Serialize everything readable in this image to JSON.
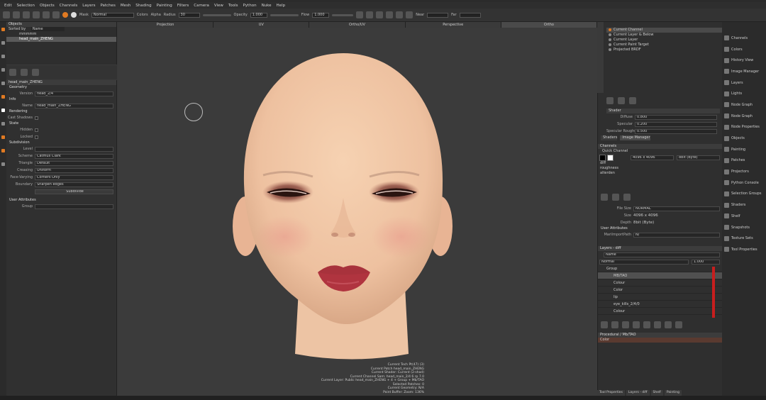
{
  "menu": [
    "Edit",
    "Selection",
    "Objects",
    "Channels",
    "Layers",
    "Patches",
    "Mesh",
    "Shading",
    "Painting",
    "Filters",
    "Camera",
    "View",
    "Tools",
    "Python",
    "Nuke",
    "Help"
  ],
  "toolbar": {
    "mask_label": "Mask",
    "mask_value": "Normal",
    "colors_label": "Colors",
    "alpha_label": "Alpha",
    "radius_label": "Radius",
    "radius_value": "30",
    "opacity_label": "Opacity",
    "opacity_value": "1.000",
    "flow_label": "Flow",
    "flow_value": "1.000",
    "near_label": "Near",
    "far_label": "Far"
  },
  "objects": {
    "title": "Objects",
    "sortby_label": "Sorted by",
    "sortby_value": "Name",
    "items": [
      "mmmmm",
      "head_main_ZHENG"
    ]
  },
  "properties": {
    "title": "head_main_ZHENG",
    "geometry": "Geometry",
    "version_label": "Version",
    "version_value": "head_2/4",
    "info": "Info",
    "name_label": "Name",
    "name_value": "head_main_ZHENG",
    "rendering": "Rendering",
    "cast_shadows": "Cast Shadows",
    "state": "State",
    "hidden": "Hidden",
    "locked": "Locked",
    "subdivision": "Subdivision",
    "level_label": "Level",
    "scheme_label": "Scheme",
    "scheme_value": "Catmull Clark",
    "triangle_label": "Triangle",
    "triangle_value": "Default",
    "creasing_label": "Creasing",
    "creasing_value": "Uniform",
    "facevarying_label": "Face-Varying",
    "facevarying_value": "Corners Only",
    "boundary_label": "Boundary",
    "boundary_value": "Sharpen edges",
    "subdivide_button": "Subdivide",
    "user_attributes": "User Attributes",
    "group_label": "Group"
  },
  "viewtabs": [
    "Projection",
    "UV",
    "Ortho/UV",
    "Perspective",
    "Ortho"
  ],
  "status_lines": [
    "Current Tech Pt(47) (3)",
    "Current Patch head_main_ZHENG",
    "Current Shader: Current (2-shad)",
    "Current Channel Sam: head_main_2/4 6 rp 7.0",
    "Current Layer: Public head_main_ZHENG + 4 + Group + Mb/TAO",
    "Selected Patches: 0",
    "Current Geometry: N/A",
    "Point Buffer: Zoom: 136%"
  ],
  "shaders": {
    "items": [
      "Current Channel",
      "Current Layer & Below",
      "Current Layer",
      "Current Paint Target",
      "Projected BRDF"
    ],
    "shader_label": "Shader",
    "diffuse_label": "Diffuse",
    "diffuse_value": "0.800",
    "specular_label": "Specular",
    "specular_value": "0.200",
    "roughness_label": "Specular Roughness",
    "roughness_value": "0.500",
    "tab_shaders": "Shaders",
    "tab_image_manager": "Image Manager"
  },
  "channels": {
    "title": "Channels",
    "quick_label": "Quick Channel",
    "size_value": "4096 x 4096",
    "depth_value": "8bit (Byte)",
    "items": [
      "diff",
      "roughness",
      "alterden"
    ],
    "filesize_label": "File Size",
    "filesize_value": "NORMAL",
    "size_label": "Size",
    "size2_value": "4096 x 4096",
    "depth_label": "Depth",
    "depth2_value": "8bit (Byte)",
    "user_attr": "User Attributes",
    "mari_label": "MariImportPath",
    "mari_value": "N/"
  },
  "layers": {
    "title": "Layers - diff",
    "filter_value": "Name",
    "blend_value": "Normal",
    "opacity_value": "1.000",
    "items": [
      "Group",
      "MB/TAO",
      "Colour",
      "Color",
      "lip",
      "eye_kills_2/4/0",
      "Colour"
    ],
    "procedural": "Procedural / Mb/TAO",
    "color_label": "Color"
  },
  "right_palettes": [
    "Channels",
    "Colors",
    "History View",
    "Image Manager",
    "Layers",
    "Lights",
    "Node Graph",
    "Node Graph",
    "Node Properties",
    "Objects",
    "Painting",
    "Patches",
    "Projectors",
    "Python Console",
    "Selection Groups",
    "Shaders",
    "Shelf",
    "Snapshots",
    "Texture Sets",
    "Tool Properties"
  ],
  "bottom_tabs": [
    "Tool Properties",
    "Layers - diff",
    "Shelf",
    "Painting"
  ],
  "colors": {
    "accent": "#e07a22",
    "skin": "#f2c6a4",
    "lips": "#a8323c",
    "redbar": "#c81e1e"
  }
}
